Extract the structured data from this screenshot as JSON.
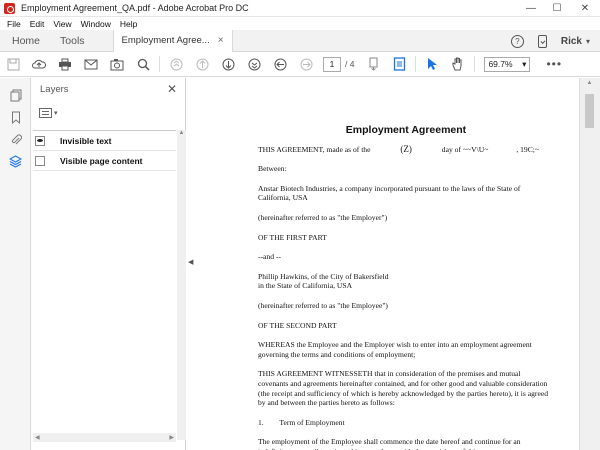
{
  "window": {
    "title": "Employment Agreement_QA.pdf - Adobe Acrobat Pro DC",
    "minimize": "—",
    "maximize": "☐",
    "close": "✕"
  },
  "menu": [
    "File",
    "Edit",
    "View",
    "Window",
    "Help"
  ],
  "tabs": {
    "home": "Home",
    "tools": "Tools",
    "document": "Employment Agree...",
    "close_glyph": "×"
  },
  "account": {
    "help_glyph": "?",
    "user": "Rick",
    "chevron": "▾"
  },
  "toolbar": {
    "current_page": "1",
    "total_pages": "/ 4",
    "zoom": "69.7%",
    "zoom_chevron": "▾",
    "more": "•••"
  },
  "layers_panel": {
    "title": "Layers",
    "close_glyph": "✕",
    "options_chevron": "▾",
    "layers": [
      {
        "name": "Invisible text",
        "visible": true
      },
      {
        "name": "Visible page content",
        "visible": false
      }
    ]
  },
  "document": {
    "title": "Employment Agreement",
    "paragraphs": {
      "p1_a": "THIS AGREEMENT, made as of the",
      "p1_b": "(Z)",
      "p1_c": "day of",
      "p1_d": "~~V\\U~",
      "p1_e": ", 19C;~",
      "p2": "Between:",
      "p3": "Anstar Biotech Industries, a company incorporated pursuant to the laws of the State of California, USA",
      "p4": "(hereinafter referred to as \"the Employer\")",
      "p5": "OF THE FIRST PART",
      "p6": "--and --",
      "p7_a": "Phillip Hawkins, of the City of Bakersfield",
      "p7_b": "in the State of California, USA",
      "p8": "(hereinafter referred to as \"the Employee\")",
      "p9": "OF THE SECOND PART",
      "p10": "WHEREAS the Employee and the Employer wish to enter into an employment agreement governing the terms and conditions of employment;",
      "p11": "THIS AGREEMENT WITNESSETH that in consideration of the premises and mutual covenants and agreements hereinafter contained, and for other good and valuable consideration (the receipt and sufficiency of which is hereby acknowledged by the parties hereto), it is agreed by and between the parties hereto as follows:",
      "p12_num": "1.",
      "p12_title": "Term of Employment",
      "p13": "The employment of the Employee shall commence the date hereof and continue for an indefinite term until terminated in accordance with the provisions of this agreement."
    }
  }
}
